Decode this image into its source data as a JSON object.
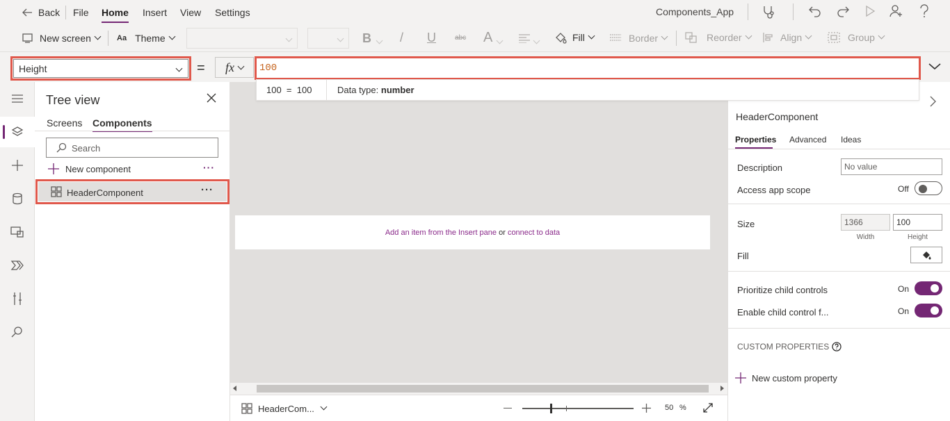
{
  "topbar": {
    "back_label": "Back",
    "menus": [
      "File",
      "Home",
      "Insert",
      "View",
      "Settings"
    ],
    "active_menu": "Home",
    "app_name": "Components_App",
    "icons": [
      "stethoscope-icon",
      "undo-icon",
      "redo-icon",
      "play-icon",
      "user-add-icon",
      "help-icon"
    ]
  },
  "toolbar": {
    "new_screen": "New screen",
    "theme": "Theme",
    "bold": "B",
    "italic": "/",
    "underline": "U",
    "strike": "abc",
    "font_color": "A",
    "fill": "Fill",
    "border": "Border",
    "reorder": "Reorder",
    "align": "Align",
    "group": "Group"
  },
  "formula": {
    "property": "Height",
    "equals": "=",
    "fx": "fx",
    "value": "100",
    "tooltip_eval": "100  =  100",
    "tooltip_type_label": "Data type: ",
    "tooltip_type_value": "number"
  },
  "tree": {
    "title": "Tree view",
    "tabs": [
      "Screens",
      "Components"
    ],
    "active_tab": "Components",
    "search_placeholder": "Search",
    "new_component": "New component",
    "items": [
      {
        "name": "HeaderComponent",
        "selected": true
      }
    ]
  },
  "canvas": {
    "hint_link1": "Add an item from the Insert pane",
    "hint_or": "or",
    "hint_link2": "connect to data",
    "selector_label": "HeaderCom...",
    "zoom_value": "50",
    "zoom_unit": "%"
  },
  "properties": {
    "component_name": "HeaderComponent",
    "tabs": [
      "Properties",
      "Advanced",
      "Ideas"
    ],
    "active_tab": "Properties",
    "description_label": "Description",
    "description_placeholder": "No value",
    "access_label": "Access app scope",
    "access_state": "Off",
    "size_label": "Size",
    "width_value": "1366",
    "height_value": "100",
    "width_caption": "Width",
    "height_caption": "Height",
    "fill_label": "Fill",
    "prioritize_label": "Prioritize child controls",
    "prioritize_state": "On",
    "enable_label": "Enable child control f...",
    "enable_state": "On",
    "custom_heading": "CUSTOM PROPERTIES",
    "new_custom": "New custom property"
  },
  "colors": {
    "accent": "#742774",
    "highlight_border": "#e0584b",
    "link": "#8a2a8a",
    "formula_value": "#c5631c"
  }
}
